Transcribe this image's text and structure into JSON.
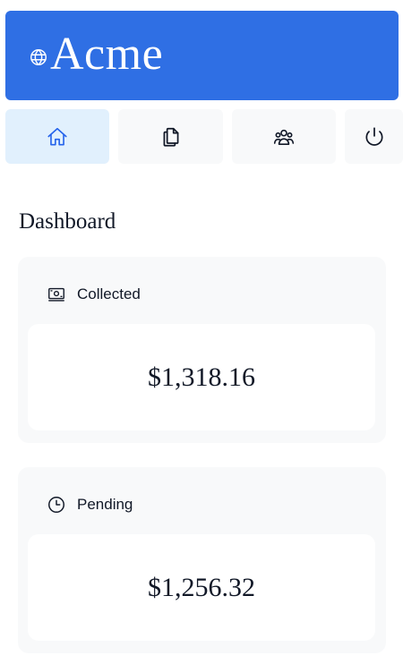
{
  "brand": {
    "name": "Acme",
    "icon": "globe-icon",
    "color": "#2f6fe4"
  },
  "nav": {
    "items": [
      {
        "icon": "home-icon",
        "active": true
      },
      {
        "icon": "documents-icon",
        "active": false
      },
      {
        "icon": "users-icon",
        "active": false
      },
      {
        "icon": "power-icon",
        "active": false
      }
    ],
    "active_color": "#2563eb",
    "active_background": "#e1f0fd"
  },
  "page": {
    "title": "Dashboard"
  },
  "cards": [
    {
      "label": "Collected",
      "icon": "banknotes-icon",
      "value": "$1,318.16"
    },
    {
      "label": "Pending",
      "icon": "clock-icon",
      "value": "$1,256.32"
    }
  ]
}
